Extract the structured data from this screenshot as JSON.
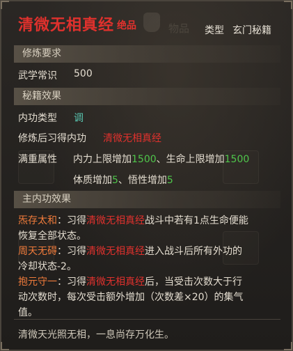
{
  "header": {
    "title": "清微无相真经",
    "grade": "绝品",
    "type_label": "类型",
    "type_value": "玄门秘籍",
    "background_tab": "物品"
  },
  "sections": {
    "requirements": "修炼要求",
    "effects": "秘籍效果",
    "main_effects": "主内功效果"
  },
  "requirements": {
    "label": "武学常识",
    "value": "500"
  },
  "effects": {
    "neigong_type_label": "内功类型",
    "neigong_type_value": "调",
    "learn_label": "修炼后习得内功",
    "learn_value": "清微无相真经",
    "full_label": "满重属性",
    "bonus1_label": "内力上限增加",
    "bonus1_value": "1500",
    "sep": "、",
    "bonus2_label": "生命上限增加",
    "bonus2_value": "1500",
    "bonus3_label": "体质增加",
    "bonus3_value": "5",
    "bonus4_label": "悟性增加",
    "bonus4_value": "5"
  },
  "main_effects": [
    {
      "name": "炁存太和",
      "pre": "：习得",
      "skill": "清微无相真经",
      "post1": "战斗中若有1点生命便能",
      "post2": "恢复全部状态。"
    },
    {
      "name": "周天无碍",
      "pre": "：习得",
      "skill": "清微无相真经",
      "post1": "进入战斗后所有外功的",
      "post2": "冷却状态-2。"
    },
    {
      "name": "抱元守一",
      "pre": "：习得",
      "skill": "清微无相真经",
      "post1": "后，当受击次数大于行",
      "post2": "动次数时，每次受击额外增加（次数差×20）的集气",
      "post3": "值。"
    }
  ],
  "flavor": "清微天光照无相，一息尚存万化生。",
  "colors": {
    "title_red": "#e0312d",
    "effect_orange": "#f07b3b",
    "value_green": "#4fc64b",
    "type_cyan": "#59c7b2"
  }
}
